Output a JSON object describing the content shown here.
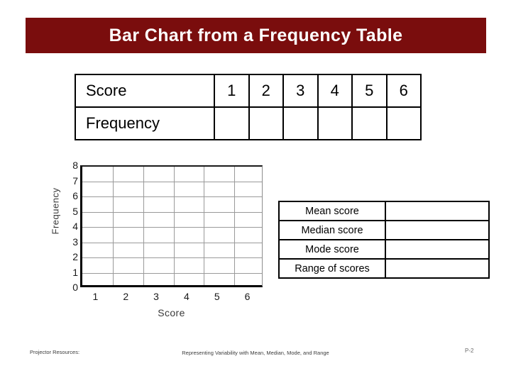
{
  "slide": {
    "title": "Bar Chart from a Frequency Table"
  },
  "frequency_table": {
    "rows": [
      {
        "label": "Score",
        "cells": [
          "1",
          "2",
          "3",
          "4",
          "5",
          "6"
        ]
      },
      {
        "label": "Frequency",
        "cells": [
          "",
          "",
          "",
          "",
          "",
          ""
        ]
      }
    ]
  },
  "stats_table": {
    "rows": [
      {
        "label": "Mean score",
        "value": ""
      },
      {
        "label": "Median score",
        "value": ""
      },
      {
        "label": "Mode score",
        "value": ""
      },
      {
        "label": "Range of scores",
        "value": ""
      }
    ]
  },
  "footer": {
    "left": "Projector Resources:",
    "center": "Representing Variability with Mean, Median, Mode, and Range",
    "right": "P-2"
  },
  "chart_data": {
    "type": "bar",
    "title": "",
    "xlabel": "Score",
    "ylabel": "Frequency",
    "categories": [
      "1",
      "2",
      "3",
      "4",
      "5",
      "6"
    ],
    "values": [
      0,
      0,
      0,
      0,
      0,
      0
    ],
    "ytick_labels": [
      "8",
      "7",
      "6",
      "5",
      "4",
      "3",
      "2",
      "1",
      "0"
    ],
    "ylim": [
      0,
      8
    ],
    "grid": true,
    "legend": "none",
    "note": "Blank grid — no bars drawn; students fill in"
  }
}
